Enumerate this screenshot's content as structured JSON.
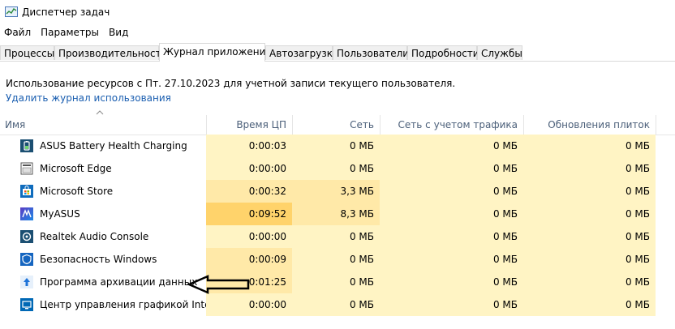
{
  "window": {
    "title": "Диспетчер задач",
    "icon": "task-manager-icon"
  },
  "menu": {
    "items": [
      "Файл",
      "Параметры",
      "Вид"
    ]
  },
  "tabs": [
    {
      "label": "Процессы",
      "active": false
    },
    {
      "label": "Производительность",
      "active": false
    },
    {
      "label": "Журнал приложений",
      "active": true
    },
    {
      "label": "Автозагрузка",
      "active": false
    },
    {
      "label": "Пользователи",
      "active": false
    },
    {
      "label": "Подробности",
      "active": false
    },
    {
      "label": "Службы",
      "active": false
    }
  ],
  "info": {
    "text": "Использование ресурсов с Пт. 27.10.2023 для учетной записи текущего пользователя.",
    "clear_link": "Удалить журнал использования"
  },
  "columns": {
    "name": "Имя",
    "cpu_time": "Время ЦП",
    "network": "Сеть",
    "metered": "Сеть с учетом трафика",
    "tile_updates": "Обновления плиток"
  },
  "rows": [
    {
      "name": "ASUS Battery Health Charging",
      "icon": "asus-battery-icon",
      "cpu_time": "0:00:03",
      "network": "0 МБ",
      "metered": "0 МБ",
      "tile_updates": "0 МБ"
    },
    {
      "name": "Microsoft Edge",
      "icon": "edge-icon",
      "cpu_time": "0:00:00",
      "network": "0 МБ",
      "metered": "0 МБ",
      "tile_updates": "0 МБ"
    },
    {
      "name": "Microsoft Store",
      "icon": "store-icon",
      "cpu_time": "0:00:32",
      "network": "3,3 МБ",
      "metered": "0 МБ",
      "tile_updates": "0 МБ"
    },
    {
      "name": "MyASUS",
      "icon": "myasus-icon",
      "cpu_time": "0:09:52",
      "network": "8,3 МБ",
      "metered": "0 МБ",
      "tile_updates": "0 МБ"
    },
    {
      "name": "Realtek Audio Console",
      "icon": "realtek-icon",
      "cpu_time": "0:00:00",
      "network": "0 МБ",
      "metered": "0 МБ",
      "tile_updates": "0 МБ"
    },
    {
      "name": "Безопасность Windows",
      "icon": "shield-icon",
      "cpu_time": "0:00:09",
      "network": "0 МБ",
      "metered": "0 МБ",
      "tile_updates": "0 МБ"
    },
    {
      "name": "Программа архивации данных",
      "icon": "backup-icon",
      "cpu_time": "0:01:25",
      "network": "0 МБ",
      "metered": "0 МБ",
      "tile_updates": "0 МБ"
    },
    {
      "name": "Центр управления графикой Intel®",
      "icon": "intel-graphics-icon",
      "cpu_time": "0:00:00",
      "network": "0 МБ",
      "metered": "0 МБ",
      "tile_updates": "0 МБ"
    }
  ],
  "colors": {
    "heat_light": "#fff4c4",
    "heat_mid": "#ffe9a8",
    "heat_high": "#ffd36b",
    "link": "#1a5eb0",
    "header_text": "#4c607a"
  }
}
